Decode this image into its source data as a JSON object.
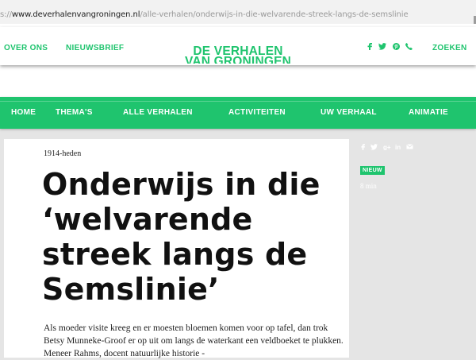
{
  "browser": {
    "url_prefix": "s://",
    "url_host": "www.deverhalenvangroningen.nl",
    "url_path": "/alle-verhalen/onderwijs-in-die-welvarende-streek-langs-de-semslinie"
  },
  "topnav": {
    "over_ons": "OVER ONS",
    "nieuwsbrief": "NIEUWSBRIEF",
    "zoeken": "ZOEKEN",
    "social_icons": [
      "facebook-icon",
      "twitter-icon",
      "pinterest-icon",
      "phone-icon"
    ]
  },
  "logo": {
    "line1": "DE VERHALEN",
    "line2": "VAN GRONINGEN"
  },
  "mainnav": {
    "items": [
      "HOME",
      "THEMA'S",
      "ALLE VERHALEN",
      "ACTIVITEITEN",
      "UW VERHAAL",
      "ANIMATIE"
    ]
  },
  "article": {
    "era": "1914-heden",
    "title": "Onderwijs in die ‘welvarende streek langs de Semslinie’",
    "intro": "Als moeder visite kreeg en er moesten bloemen komen voor op tafel, dan trok Betsy Munneke-Groof er op uit om langs de waterkant een veldboeket te plukken. Meneer Rahms, docent natuurlijke historie -"
  },
  "sidebar": {
    "share_icons": [
      "facebook-icon",
      "twitter-icon",
      "google-plus-icon",
      "linkedin-icon",
      "mail-icon"
    ],
    "badge": "NIEUW",
    "read_time": "8 min"
  },
  "colors": {
    "brand_green": "#1fc46e",
    "page_bg": "#e5e5e5"
  }
}
